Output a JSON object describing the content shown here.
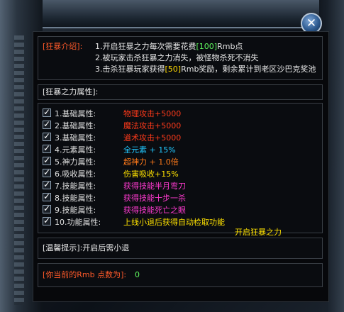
{
  "window": {
    "close_glyph": "✕"
  },
  "intro": {
    "label": "[狂暴介绍]:",
    "line1_prefix": "1.开启狂暴之力每次需要花费",
    "line1_cost": "[100]",
    "line1_suffix": "Rmb点",
    "line2": "2.被玩家击杀狂暴之力消失，被怪物杀死不消失",
    "line3_prefix": "3.击杀狂暴玩家获得",
    "line3_reward": "[50]",
    "line3_suffix": "Rmb奖励，剩余累计到老区沙巴克奖池"
  },
  "attributes": {
    "header": "[狂暴之力属性]:",
    "rows": [
      {
        "label": "1.基础属性:",
        "value": "物理攻击+5000",
        "color": "#ff3a1a"
      },
      {
        "label": "2.基础属性:",
        "value": "魔法攻击+5000",
        "color": "#ff3a1a"
      },
      {
        "label": "3.基础属性:",
        "value": "道术攻击+5000",
        "color": "#ff3a1a"
      },
      {
        "label": "4.元素属性:",
        "value": "全元素 + 15%",
        "color": "#22c8ff"
      },
      {
        "label": "5.神力属性:",
        "value": "超神力 + 1.0倍",
        "color": "#ff7a1a"
      },
      {
        "label": "6.吸收属性:",
        "value": "伤害吸收+15%",
        "color": "#ffe200"
      },
      {
        "label": "7.技能属性:",
        "value": "获得技能半月弯刀",
        "color": "#ff3ad0"
      },
      {
        "label": "8.技能属性:",
        "value": "获得技能十步一杀",
        "color": "#ff3ad0"
      },
      {
        "label": "9.技能属性:",
        "value": "获得技能死亡之眼",
        "color": "#ff3ad0"
      },
      {
        "label": "10.功能属性:",
        "value": "上线小退后获得自动检取功能",
        "color": "#ffe200"
      }
    ]
  },
  "open_button": "开启狂暴之力",
  "tip": {
    "text": "[温馨提示]:开启后需小退"
  },
  "rmb": {
    "label": "[你当前的Rmb 点数为]:",
    "value": "0"
  }
}
